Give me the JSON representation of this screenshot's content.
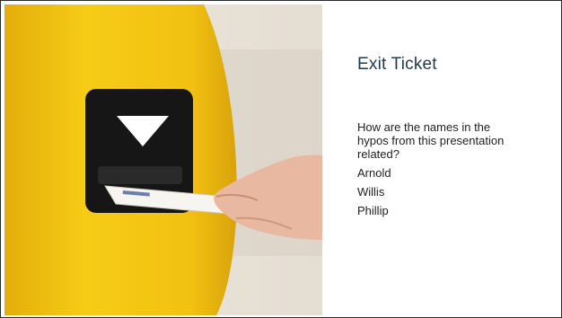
{
  "slide": {
    "title": "Exit Ticket",
    "body": [
      "How are the names in the hypos from this presentation related?",
      "Arnold",
      "Willis",
      "Phillip"
    ]
  },
  "colors": {
    "title": "#1f3a4d",
    "body_text": "#222222",
    "machine_yellow": "#f2c514",
    "slot_black": "#1a1a1a",
    "arrow_white": "#ffffff"
  }
}
